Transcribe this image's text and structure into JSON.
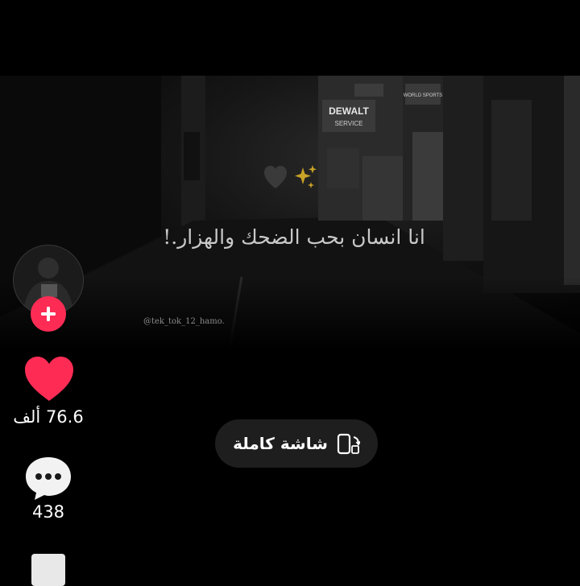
{
  "video": {
    "caption": "انا انسان بحب الضحك والهزار.!",
    "watermark": "@tek_tok_12_hamo.",
    "sign_text": "DEWALT",
    "sign_subtext": "SERVICE",
    "shop_sign": "WORLD SPORTS"
  },
  "sidebar": {
    "like_count": "76.6 ألف",
    "comment_count": "438"
  },
  "fullscreen_button": {
    "label": "شاشة كاملة",
    "icon": "rotate-screen-icon"
  },
  "colors": {
    "accent": "#fe2c55",
    "background": "#000000",
    "button_bg": "#1e1e1e"
  }
}
